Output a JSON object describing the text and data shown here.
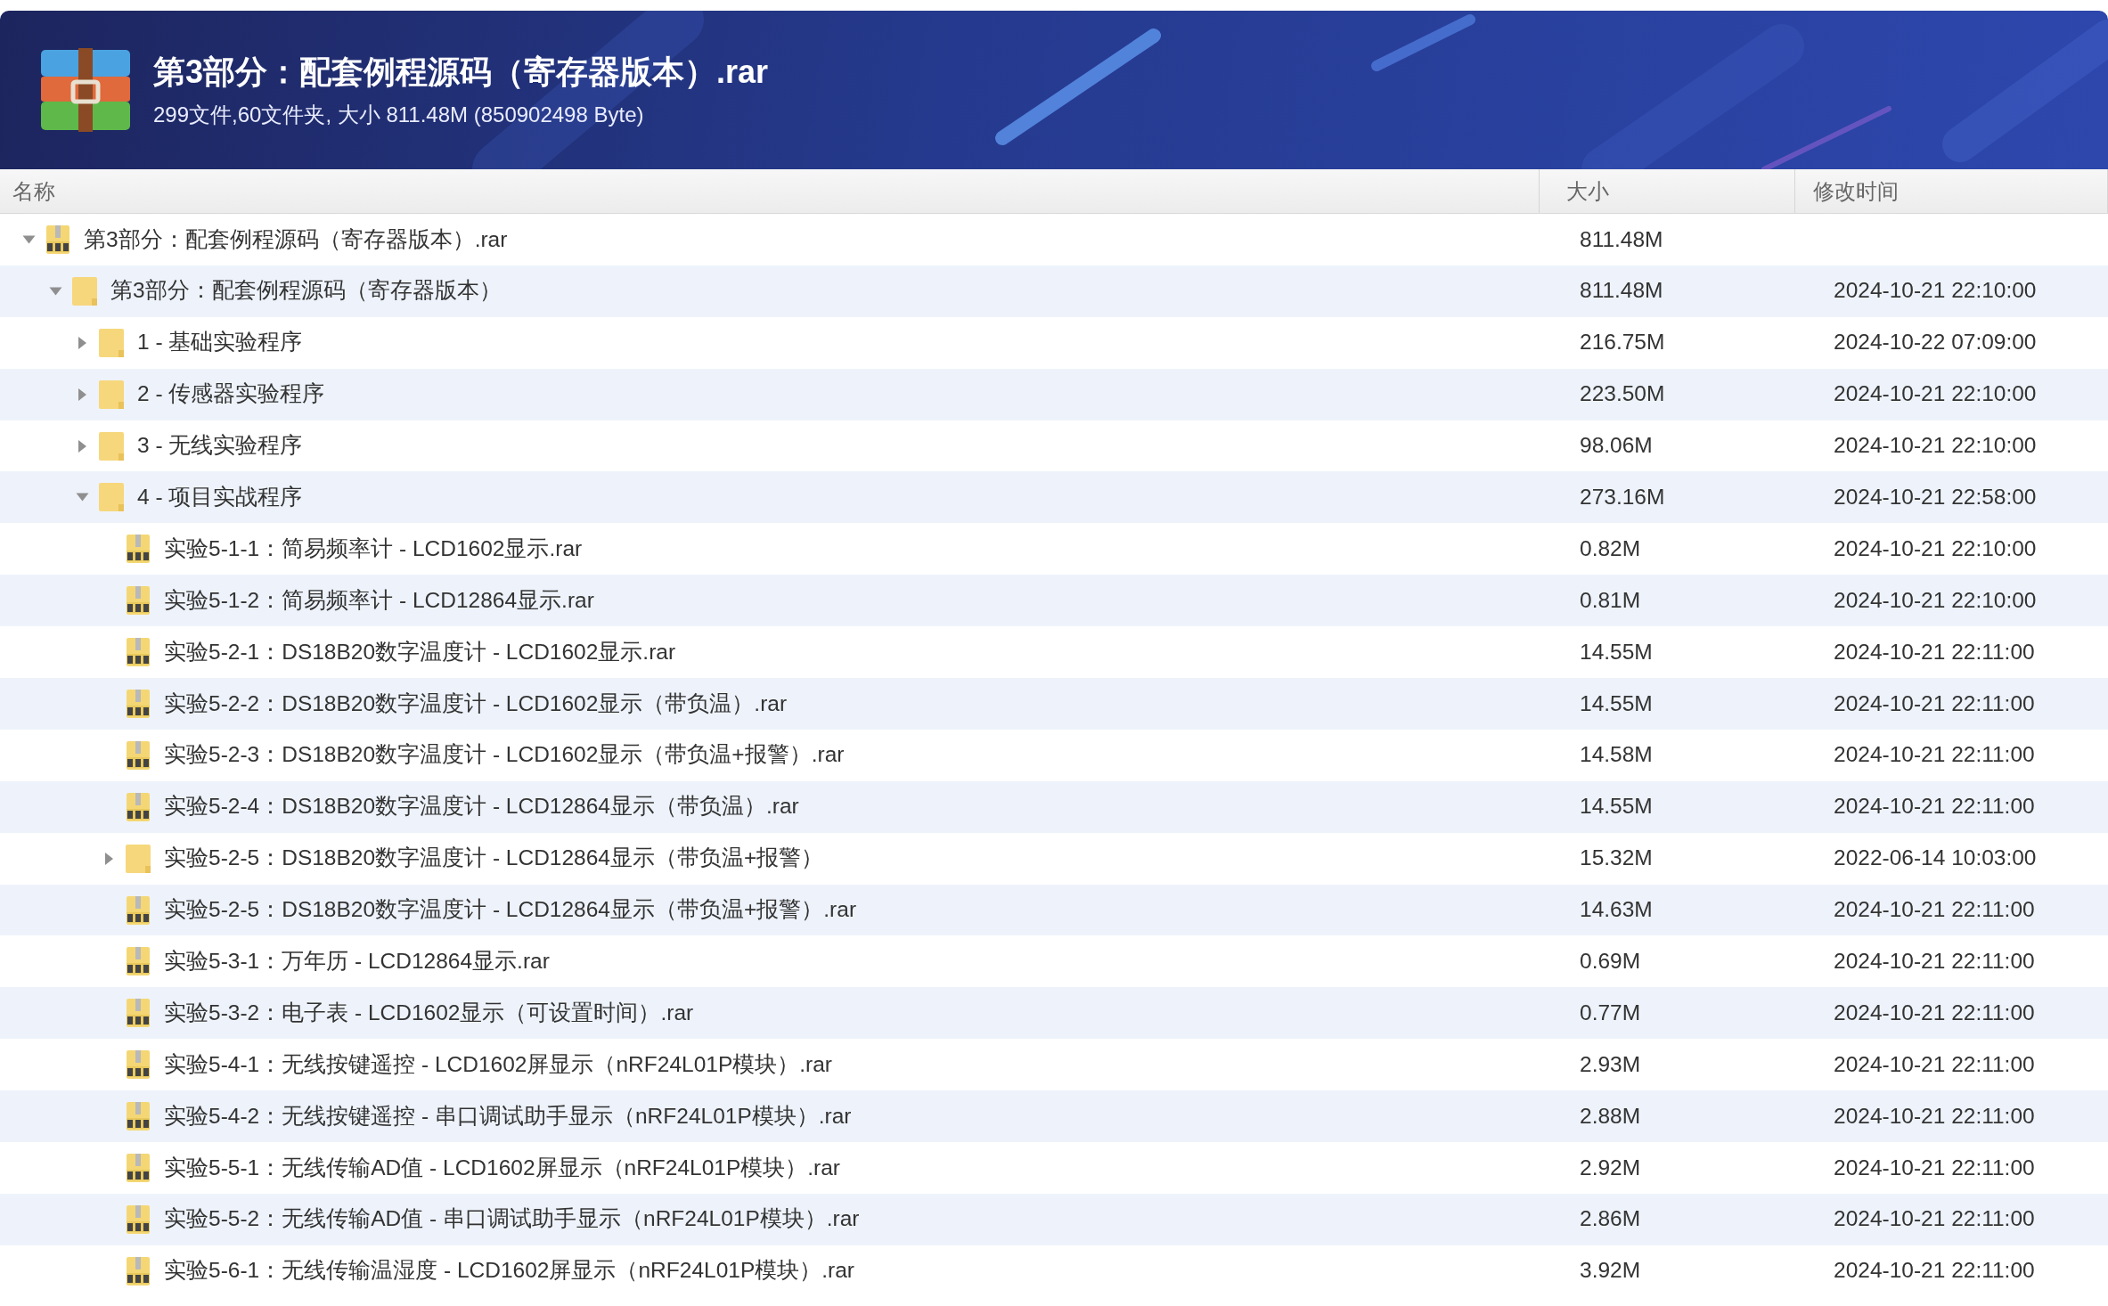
{
  "archive": {
    "title": "第3部分：配套例程源码（寄存器版本）.rar",
    "summary": "299文件,60文件夹, 大小 811.48M (850902498 Byte)"
  },
  "columns": [
    {
      "label": "名称"
    },
    {
      "label": "大小"
    },
    {
      "label": "修改时间"
    }
  ],
  "tree": [
    {
      "kind": "archive",
      "name": "第3部分：配套例程源码（寄存器版本）.rar",
      "size": "811.48M",
      "expanded": true,
      "children": [
        {
          "kind": "folder",
          "name": "第3部分：配套例程源码（寄存器版本）",
          "size": "811.48M",
          "modified": "2024-10-21 22:10:00",
          "expanded": true,
          "children": [
            {
              "kind": "folder",
              "name": "1 - 基础实验程序",
              "size": "216.75M",
              "modified": "2024-10-22 07:09:00",
              "expanded": false
            },
            {
              "kind": "folder",
              "name": "2 - 传感器实验程序",
              "size": "223.50M",
              "modified": "2024-10-21 22:10:00",
              "expanded": false
            },
            {
              "kind": "folder",
              "name": "3 - 无线实验程序",
              "size": "98.06M",
              "modified": "2024-10-21 22:10:00",
              "expanded": false
            },
            {
              "kind": "folder",
              "name": "4 - 项目实战程序",
              "size": "273.16M",
              "modified": "2024-10-21 22:58:00",
              "expanded": true,
              "children": [
                {
                  "kind": "archive",
                  "name": "实验5-1-1：简易频率计 - LCD1602显示.rar",
                  "size": "0.82M",
                  "modified": "2024-10-21 22:10:00"
                },
                {
                  "kind": "archive",
                  "name": "实验5-1-2：简易频率计 - LCD12864显示.rar",
                  "size": "0.81M",
                  "modified": "2024-10-21 22:10:00"
                },
                {
                  "kind": "archive",
                  "name": "实验5-2-1：DS18B20数字温度计 - LCD1602显示.rar",
                  "size": "14.55M",
                  "modified": "2024-10-21 22:11:00"
                },
                {
                  "kind": "archive",
                  "name": "实验5-2-2：DS18B20数字温度计 - LCD1602显示（带负温）.rar",
                  "size": "14.55M",
                  "modified": "2024-10-21 22:11:00"
                },
                {
                  "kind": "archive",
                  "name": "实验5-2-3：DS18B20数字温度计 - LCD1602显示（带负温+报警）.rar",
                  "size": "14.58M",
                  "modified": "2024-10-21 22:11:00"
                },
                {
                  "kind": "archive",
                  "name": "实验5-2-4：DS18B20数字温度计 - LCD12864显示（带负温）.rar",
                  "size": "14.55M",
                  "modified": "2024-10-21 22:11:00"
                },
                {
                  "kind": "folder",
                  "name": "实验5-2-5：DS18B20数字温度计 - LCD12864显示（带负温+报警）",
                  "size": "15.32M",
                  "modified": "2022-06-14 10:03:00",
                  "expanded": false
                },
                {
                  "kind": "archive",
                  "name": "实验5-2-5：DS18B20数字温度计 - LCD12864显示（带负温+报警）.rar",
                  "size": "14.63M",
                  "modified": "2024-10-21 22:11:00"
                },
                {
                  "kind": "archive",
                  "name": "实验5-3-1：万年历 - LCD12864显示.rar",
                  "size": "0.69M",
                  "modified": "2024-10-21 22:11:00"
                },
                {
                  "kind": "archive",
                  "name": "实验5-3-2：电子表 - LCD1602显示（可设置时间）.rar",
                  "size": "0.77M",
                  "modified": "2024-10-21 22:11:00"
                },
                {
                  "kind": "archive",
                  "name": "实验5-4-1：无线按键遥控 - LCD1602屏显示（nRF24L01P模块）.rar",
                  "size": "2.93M",
                  "modified": "2024-10-21 22:11:00"
                },
                {
                  "kind": "archive",
                  "name": "实验5-4-2：无线按键遥控 - 串口调试助手显示（nRF24L01P模块）.rar",
                  "size": "2.88M",
                  "modified": "2024-10-21 22:11:00"
                },
                {
                  "kind": "archive",
                  "name": "实验5-5-1：无线传输AD值 - LCD1602屏显示（nRF24L01P模块）.rar",
                  "size": "2.92M",
                  "modified": "2024-10-21 22:11:00"
                },
                {
                  "kind": "archive",
                  "name": "实验5-5-2：无线传输AD值 - 串口调试助手显示（nRF24L01P模块）.rar",
                  "size": "2.86M",
                  "modified": "2024-10-21 22:11:00"
                },
                {
                  "kind": "archive",
                  "name": "实验5-6-1：无线传输温湿度 - LCD1602屏显示（nRF24L01P模块）.rar",
                  "size": "3.92M",
                  "modified": "2024-10-21 22:11:00"
                }
              ]
            }
          ]
        }
      ]
    }
  ]
}
